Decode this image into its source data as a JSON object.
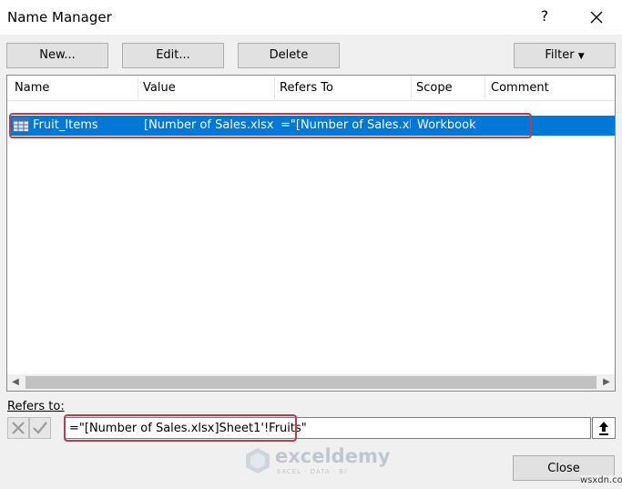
{
  "window": {
    "title": "Name Manager",
    "help": "?"
  },
  "toolbar": {
    "new_label": "New...",
    "edit_label": "Edit...",
    "delete_label": "Delete",
    "filter_label": "Filter"
  },
  "columns": [
    "Name",
    "Value",
    "Refers To",
    "Scope",
    "Comment"
  ],
  "rows": [
    {
      "name": "Fruit_Items",
      "value": "[Number of Sales.xlsx...",
      "refers_to": "=\"[Number of Sales.xl...",
      "scope": "Workbook",
      "comment": ""
    }
  ],
  "refers_to": {
    "label": "Refers to:",
    "value": "=\"[Number of Sales.xlsx]Sheet1'!Fruits\""
  },
  "footer": {
    "close_label": "Close"
  },
  "watermark": {
    "name": "exceldemy",
    "tagline": "EXCEL · DATA · BI"
  },
  "corner_text": "wsxdn.com",
  "colors": {
    "selection": "#0078d7",
    "annotation": "#c0394d"
  }
}
